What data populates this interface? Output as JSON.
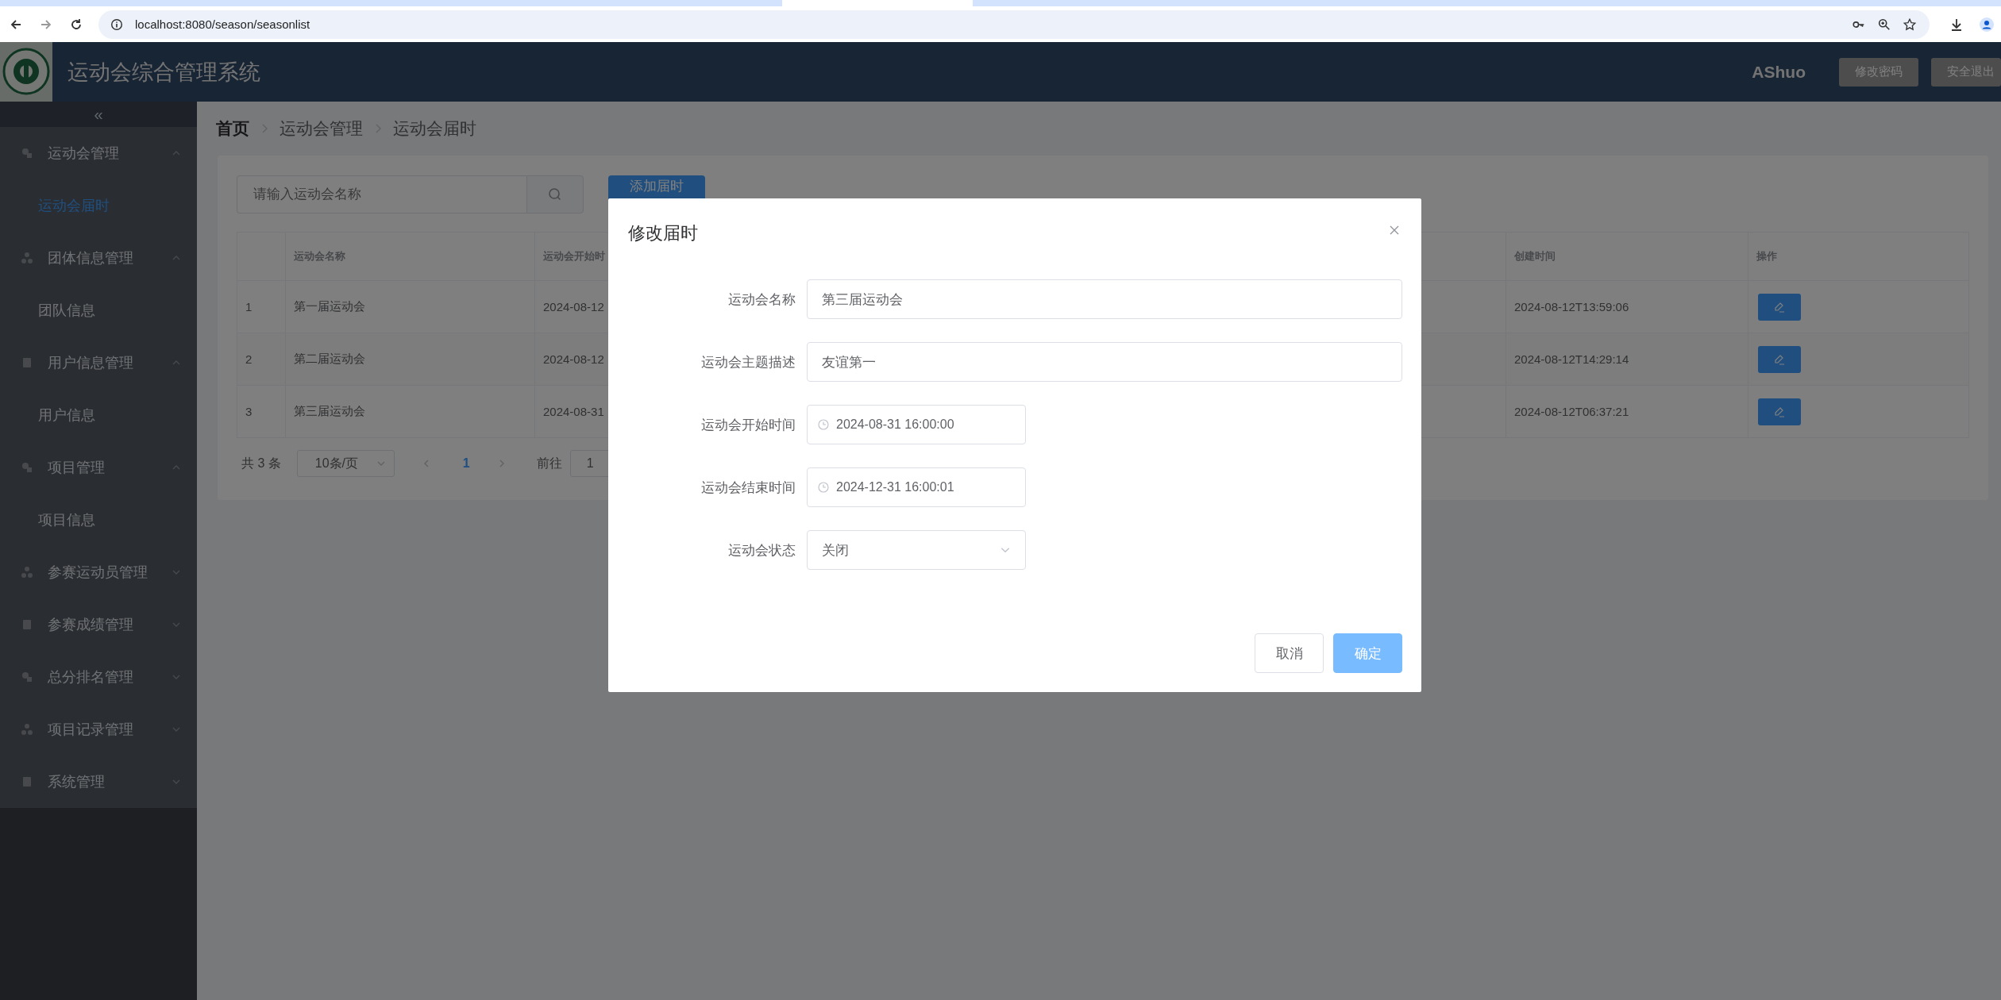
{
  "browser": {
    "url": "localhost:8080/season/seasonlist"
  },
  "header": {
    "title": "运动会综合管理系统",
    "user": "AShuo",
    "buttons": [
      "修改密码",
      "安全退出"
    ]
  },
  "sidebar": {
    "collapse": "«",
    "items": [
      {
        "label": "运动会管理",
        "expanded": true,
        "children": [
          {
            "label": "运动会届时",
            "selected": true
          }
        ]
      },
      {
        "label": "团体信息管理",
        "expanded": true,
        "children": [
          {
            "label": "团队信息",
            "selected": false
          }
        ]
      },
      {
        "label": "用户信息管理",
        "expanded": true,
        "children": [
          {
            "label": "用户信息",
            "selected": false
          }
        ]
      },
      {
        "label": "项目管理",
        "expanded": true,
        "children": [
          {
            "label": "项目信息",
            "selected": false
          }
        ]
      },
      {
        "label": "参赛运动员管理",
        "expanded": false
      },
      {
        "label": "参赛成绩管理",
        "expanded": false
      },
      {
        "label": "总分排名管理",
        "expanded": false
      },
      {
        "label": "项目记录管理",
        "expanded": false
      },
      {
        "label": "系统管理",
        "expanded": false
      }
    ]
  },
  "breadcrumb": [
    "首页",
    "运动会管理",
    "运动会届时"
  ],
  "search": {
    "placeholder": "请输入运动会名称"
  },
  "add_button": "添加届时",
  "table": {
    "columns": [
      "运动会名称",
      "运动会开始时",
      "创建时间",
      "操作"
    ],
    "rows": [
      {
        "index": "1",
        "name": "第一届运动会",
        "start": "2024-08-12",
        "created": "2024-08-12T13:59:06"
      },
      {
        "index": "2",
        "name": "第二届运动会",
        "start": "2024-08-12",
        "created": "2024-08-12T14:29:14"
      },
      {
        "index": "3",
        "name": "第三届运动会",
        "start": "2024-08-31",
        "created": "2024-08-12T06:37:21"
      }
    ]
  },
  "pagination": {
    "total": "共 3 条",
    "page_size": "10条/页",
    "pages": [
      {
        "label": "1",
        "selected": true
      }
    ],
    "goto_label": "前往",
    "goto_value": "1"
  },
  "dialog": {
    "title": "修改届时",
    "fields": [
      {
        "kind": "text",
        "label": "运动会名称",
        "value": "第三届运动会"
      },
      {
        "kind": "text",
        "label": "运动会主题描述",
        "value": "友谊第一"
      },
      {
        "kind": "datetime",
        "label": "运动会开始时间",
        "value": "2024-08-31 16:00:00"
      },
      {
        "kind": "datetime",
        "label": "运动会结束时间",
        "value": "2024-12-31 16:00:01"
      },
      {
        "kind": "select",
        "label": "运动会状态",
        "value": "关闭"
      }
    ],
    "buttons": [
      {
        "label": "取消",
        "kind": "default"
      },
      {
        "label": "确定",
        "kind": "primary"
      }
    ]
  }
}
